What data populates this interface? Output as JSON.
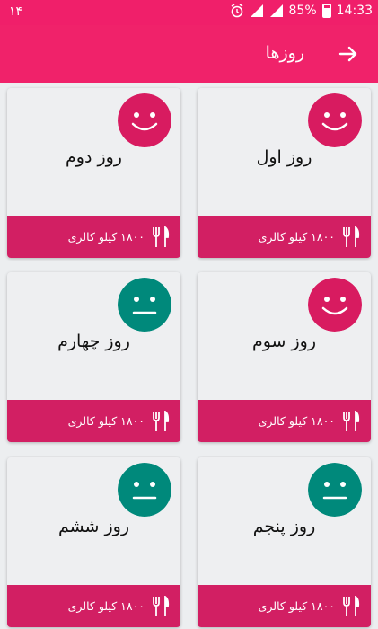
{
  "status_bar": {
    "left_text": "۱۴",
    "battery": "85%",
    "time": "14:33"
  },
  "app_bar": {
    "title": "روزها"
  },
  "colors": {
    "happy": "#d81b60",
    "neutral": "#00897b",
    "primary": "#f0226a",
    "footer": "#d21f63"
  },
  "days": [
    {
      "name": "روز اول",
      "calories": "۱۸۰۰ کیلو کالری",
      "mood": "happy"
    },
    {
      "name": "روز دوم",
      "calories": "۱۸۰۰ کیلو کالری",
      "mood": "happy"
    },
    {
      "name": "روز سوم",
      "calories": "۱۸۰۰ کیلو کالری",
      "mood": "happy"
    },
    {
      "name": "روز چهارم",
      "calories": "۱۸۰۰ کیلو کالری",
      "mood": "neutral"
    },
    {
      "name": "روز پنجم",
      "calories": "۱۸۰۰ کیلو کالری",
      "mood": "neutral"
    },
    {
      "name": "روز ششم",
      "calories": "۱۸۰۰ کیلو کالری",
      "mood": "neutral"
    }
  ]
}
